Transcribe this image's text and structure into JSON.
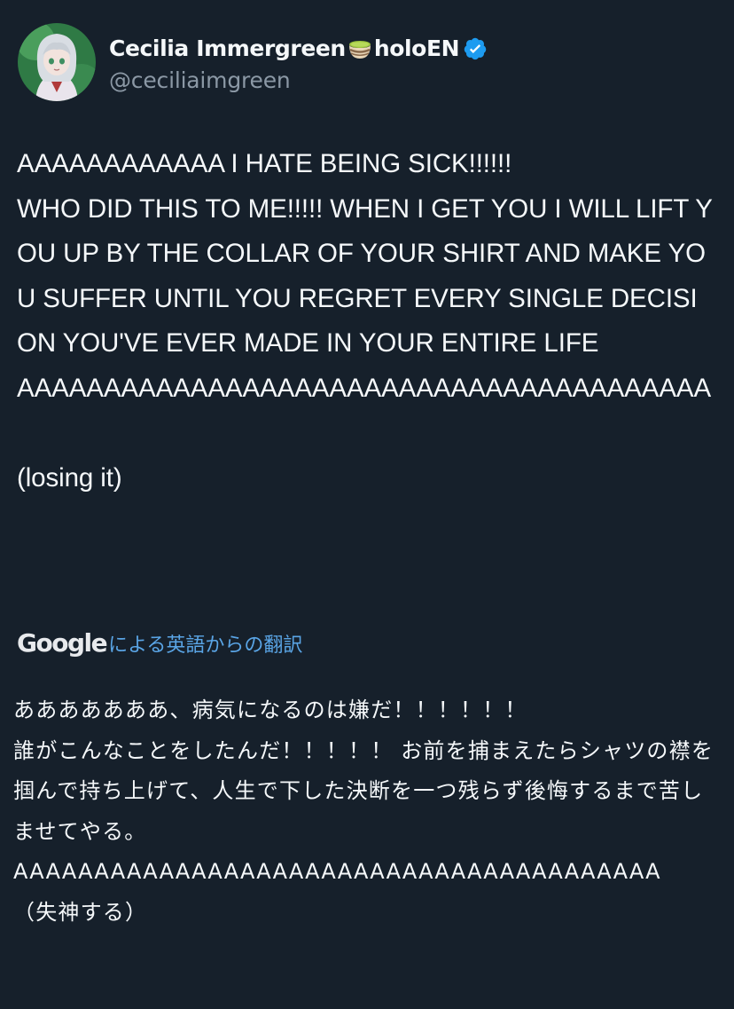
{
  "author": {
    "display_name": "Cecilia Immergreen",
    "display_name_suffix": "holoEN",
    "emoji_icon": "green-tea-icon",
    "verified_icon": "verified-badge-icon",
    "handle": "@ceciliaimgreen",
    "avatar_icon": "avatar-anime-character"
  },
  "tweet": {
    "text": "AAAAAAAAAAAA I HATE BEING SICK!!!!!!\nWHO DID THIS TO ME!!!!! WHEN I GET YOU I WILL LIFT YOU UP BY THE COLLAR OF YOUR SHIRT AND MAKE YOU SUFFER UNTIL YOU REGRET EVERY SINGLE DECISION YOU'VE EVER MADE IN YOUR ENTIRE LIFE\nAAAAAAAAAAAAAAAAAAAAAAAAAAAAAAAAAAAAAAAA\n\n(losing it)"
  },
  "translation": {
    "provider": "Google",
    "label": "による英語からの翻訳",
    "text": "あああああああ、病気になるのは嫌だ！！！！！！\n誰がこんなことをしたんだ！！！！！ お前を捕まえたらシャツの襟を掴んで持ち上げて、人生で下した決断を一つ残らず後悔するまで苦しませてやる。\nAAAAAAAAAAAAAAAAAAAAAAAAAAAAAAAAAAAAAAAA\n（失神する）"
  },
  "colors": {
    "background": "#16202b",
    "text": "#f5f8fa",
    "secondary_text": "#8b98a5",
    "link": "#5aa5e6",
    "verified": "#1d9bf0"
  }
}
